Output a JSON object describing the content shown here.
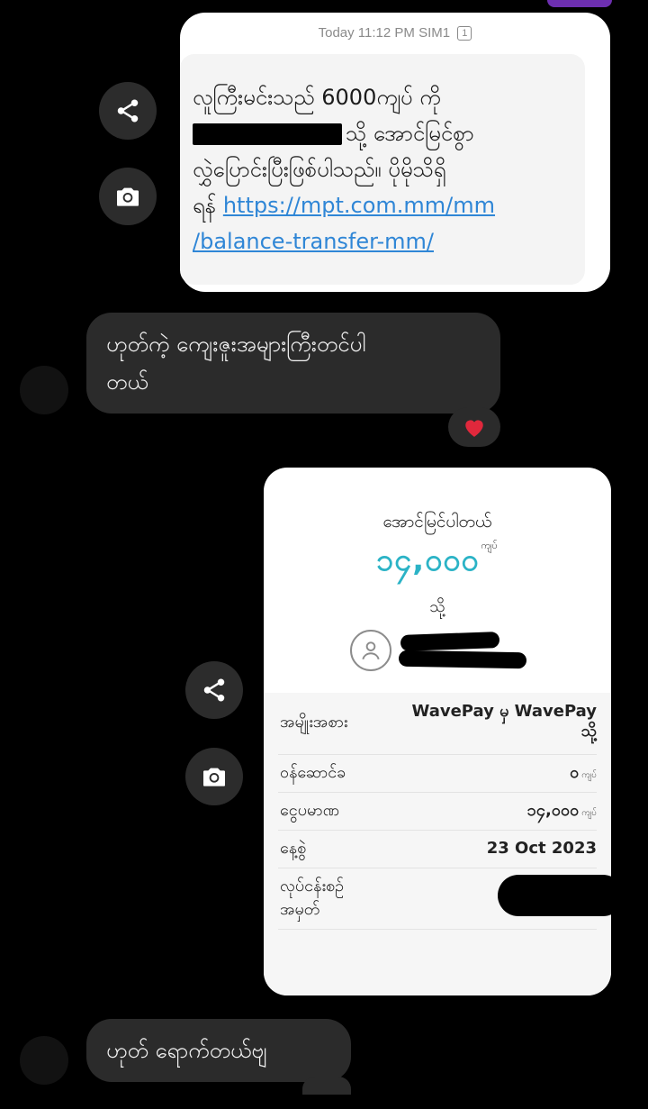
{
  "sms": {
    "timestamp": "Today 11:12 PM",
    "sim_label": "SIM1",
    "sim_number": "1",
    "line1": "လူကြီးမင်းသည် 6000ကျပ် ကို",
    "line2_suffix": "သို့ အောင်မြင်စွာ",
    "line3": "လွှဲပြောင်းပြီးဖြစ်ပါသည်။ ပိုမိုသိရှိ",
    "line4_prefix": "ရန်",
    "link_part1": "https://mpt.com.mm/mm",
    "link_part2": "/balance-transfer-mm/"
  },
  "messages": {
    "msg1_line1": "ဟုတ်ကဲ့ ကျေးဇူးအများကြီးတင်ပါ",
    "msg1_line2": "တယ်",
    "reaction": "❤️",
    "msg2": "ဟုတ် ရောက်တယ်ဗျ"
  },
  "receipt": {
    "success": "အောင်မြင်ပါတယ်",
    "amount": "၁၄,၀၀၀",
    "amount_unit": "ကျပ်",
    "to_label": "သို့",
    "rows": {
      "type_label": "အမျိုးအစား",
      "type_value_line1": "WavePay မှ WavePay",
      "type_value_line2": "သို့",
      "fee_label": "ဝန်ဆောင်ခ",
      "fee_value": "၀",
      "fee_unit": "ကျပ်",
      "amount_label": "ငွေပမာဏ",
      "amount_value": "၁၄,၀၀၀",
      "amount_unit": "ကျပ်",
      "date_label": "နေ့စွဲ",
      "date_value": "23 Oct 2023",
      "txid_label_line1": "လုပ်ငန်းစဉ်",
      "txid_label_line2": "အမှတ်"
    }
  },
  "icons": {
    "share": "share-icon",
    "camera": "camera-icon",
    "heart": "heart-icon",
    "person": "person-icon"
  },
  "colors": {
    "background": "#000000",
    "bubble_dark": "#2b2b2b",
    "link": "#2f86d6",
    "amount_accent": "#2bb3c6",
    "heart": "#e0283c"
  }
}
